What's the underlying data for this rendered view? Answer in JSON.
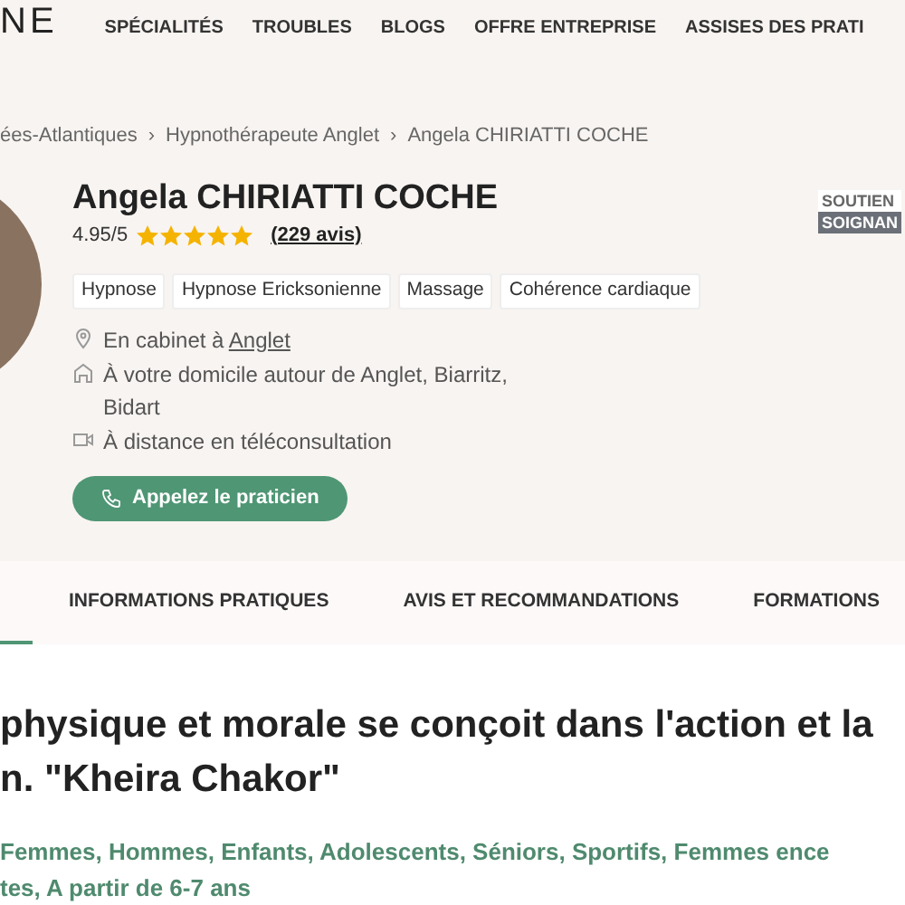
{
  "header": {
    "logo": "NE",
    "nav": [
      "SPÉCIALITÉS",
      "TROUBLES",
      "BLOGS",
      "OFFRE ENTREPRISE",
      "ASSISES DES PRATI"
    ]
  },
  "breadcrumb": [
    "ées-Atlantiques",
    "Hypnothérapeute Anglet",
    "Angela CHIRIATTI COCHE"
  ],
  "breadcrumb_separator": "›",
  "profile": {
    "name": "Angela CHIRIATTI COCHE",
    "rating": "4.95/5",
    "stars": 5,
    "reviews": "(229 avis)",
    "tags": [
      "Hypnose",
      "Hypnose Ericksonienne",
      "Massage",
      "Cohérence cardiaque"
    ],
    "locations": [
      {
        "kind": "pin",
        "text": "En cabinet à ",
        "link": "Anglet"
      },
      {
        "kind": "home",
        "text": "À votre domicile autour de Anglet, Biarritz, Bidart"
      },
      {
        "kind": "video",
        "text": "À distance en téléconsultation"
      }
    ],
    "call_button": "Appelez le praticien",
    "badge": [
      "SOUTIEN",
      "SOIGNAN"
    ]
  },
  "tabs": [
    {
      "label": "INFORMATIONS PRATIQUES",
      "selected": false
    },
    {
      "label": "AVIS ET RECOMMANDATIONS",
      "selected": false
    },
    {
      "label": "FORMATIONS",
      "selected": false
    }
  ],
  "quote": [
    "physique et morale se conçoit dans l'action et la",
    "n. \"Kheira Chakor\""
  ],
  "audience": [
    "Femmes, Hommes, Enfants, Adolescents, Séniors, Sportifs, Femmes ence",
    "tes, A partir de 6-7 ans"
  ]
}
